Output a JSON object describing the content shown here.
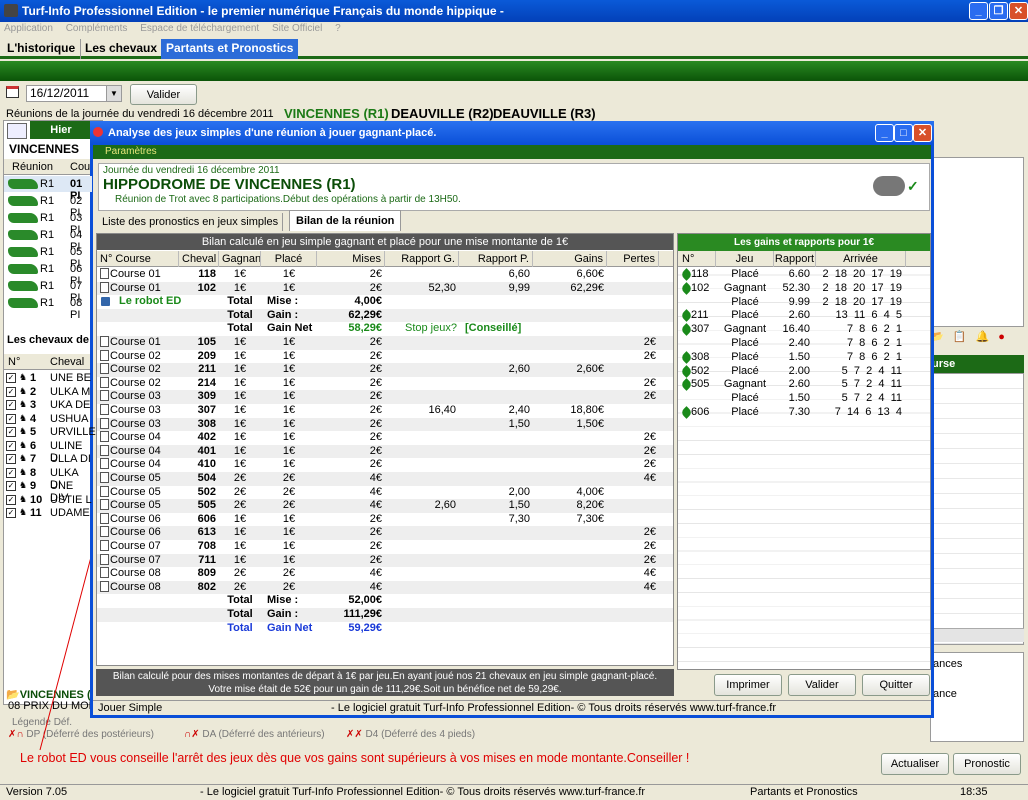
{
  "app": {
    "title": "Turf-Info Professionnel Edition - le premier numérique Français du monde hippique -"
  },
  "menu": [
    "Application",
    "Compléments",
    "Espace de téléchargement",
    "Site Officiel",
    "?"
  ],
  "tabs": [
    "L'historique",
    "Les chevaux",
    "Partants et Pronostics"
  ],
  "date": {
    "value": "16/12/2011",
    "valider": "Valider"
  },
  "reunions_label": "Réunions de la journée du vendredi 16 décembre 2011",
  "reunions": [
    "VINCENNES (R1)",
    "DEAUVILLE (R2)",
    "DEAUVILLE (R3)"
  ],
  "left": {
    "hier": "Hier",
    "venue": "VINCENNES",
    "headers": [
      "Réunion",
      "Cou"
    ],
    "rows": [
      [
        "R1",
        "01 PI"
      ],
      [
        "R1",
        "02 PI"
      ],
      [
        "R1",
        "03 PI"
      ],
      [
        "R1",
        "04 PI"
      ],
      [
        "R1",
        "05 PI"
      ],
      [
        "R1",
        "06 PI"
      ],
      [
        "R1",
        "07 PI"
      ],
      [
        "R1",
        "08 PI"
      ]
    ],
    "chevaux_label": "Les chevaux de",
    "horse_headers": [
      "N°",
      "Cheval"
    ],
    "horses": [
      [
        "1",
        "UNE BE"
      ],
      [
        "2",
        "ULKA M"
      ],
      [
        "3",
        "UKA DE"
      ],
      [
        "4",
        "USHUA"
      ],
      [
        "5",
        "URVILLE"
      ],
      [
        "6",
        "ULINE D"
      ],
      [
        "7",
        "ULLA DI"
      ],
      [
        "8",
        "ULKA DI"
      ],
      [
        "9",
        "UNE DIV"
      ],
      [
        "10",
        "USTIE L"
      ],
      [
        "11",
        "UDAME"
      ]
    ],
    "vincennes_bottom": "VINCENNES (",
    "prix": "08 PRIX DU MOR",
    "legende": "Légende Déf.",
    "legend_items": [
      "DP (Déferré des postérieurs)",
      "DA (Déferré des antérieurs)",
      "D4 (Déferré des 4 pieds)"
    ]
  },
  "annotation": "Le robot ED vous conseille l'arrêt des jeux dès que vos gains sont supérieurs à vos mises en mode montante.Conseiller !",
  "right_panel_label": "urse",
  "right_list": [
    "ances",
    "ance"
  ],
  "right_buttons": {
    "actualiser": "Actualiser",
    "pronostic": "Pronostic"
  },
  "dialog": {
    "title": "Analyse des jeux simples d'une réunion à jouer gagnant-placé.",
    "params": "Paramètres",
    "journee": "Journée du vendredi 16 décembre 2011",
    "hippodrome": "HIPPODROME DE  VINCENNES (R1)",
    "info": "Réunion de Trot avec 8 participations.Début des opérations à partir de 13H50.",
    "tabs": [
      "Liste des pronostics en jeux simples",
      "Bilan de la réunion"
    ],
    "bilan_title": "Bilan calculé en jeu simple gagnant et placé pour une mise montante de 1€",
    "headers": [
      "N° Course",
      "Cheval",
      "Gagnant",
      "Placé",
      "Mises",
      "Rapport G.",
      "Rapport P.",
      "Gains",
      "Pertes"
    ],
    "rows1": [
      [
        "Course 01",
        "118",
        "1€",
        "1€",
        "2€",
        "",
        "6,60",
        "6,60€",
        ""
      ],
      [
        "Course 01",
        "102",
        "1€",
        "1€",
        "2€",
        "52,30",
        "9,99",
        "62,29€",
        ""
      ]
    ],
    "robot": "Le robot   ED",
    "sum1": [
      [
        "Total",
        "Mise :",
        "4,00€"
      ],
      [
        "Total",
        "Gain :",
        "62,29€"
      ],
      [
        "Total",
        "Gain Net",
        "58,29€"
      ]
    ],
    "stop": "Stop jeux?",
    "conseille": "[Conseillé]",
    "rows2": [
      [
        "Course 01",
        "105",
        "1€",
        "1€",
        "2€",
        "",
        "",
        "",
        "2€"
      ],
      [
        "Course 02",
        "209",
        "1€",
        "1€",
        "2€",
        "",
        "",
        "",
        "2€"
      ],
      [
        "Course 02",
        "211",
        "1€",
        "1€",
        "2€",
        "",
        "2,60",
        "2,60€",
        ""
      ],
      [
        "Course 02",
        "214",
        "1€",
        "1€",
        "2€",
        "",
        "",
        "",
        "2€"
      ],
      [
        "Course 03",
        "309",
        "1€",
        "1€",
        "2€",
        "",
        "",
        "",
        "2€"
      ],
      [
        "Course 03",
        "307",
        "1€",
        "1€",
        "2€",
        "16,40",
        "2,40",
        "18,80€",
        ""
      ],
      [
        "Course 03",
        "308",
        "1€",
        "1€",
        "2€",
        "",
        "1,50",
        "1,50€",
        ""
      ],
      [
        "Course 04",
        "402",
        "1€",
        "1€",
        "2€",
        "",
        "",
        "",
        "2€"
      ],
      [
        "Course 04",
        "401",
        "1€",
        "1€",
        "2€",
        "",
        "",
        "",
        "2€"
      ],
      [
        "Course 04",
        "410",
        "1€",
        "1€",
        "2€",
        "",
        "",
        "",
        "2€"
      ],
      [
        "Course 05",
        "504",
        "2€",
        "2€",
        "4€",
        "",
        "",
        "",
        "4€"
      ],
      [
        "Course 05",
        "502",
        "2€",
        "2€",
        "4€",
        "",
        "2,00",
        "4,00€",
        ""
      ],
      [
        "Course 05",
        "505",
        "2€",
        "2€",
        "4€",
        "2,60",
        "1,50",
        "8,20€",
        ""
      ],
      [
        "Course 06",
        "606",
        "1€",
        "1€",
        "2€",
        "",
        "7,30",
        "7,30€",
        ""
      ],
      [
        "Course 06",
        "613",
        "1€",
        "1€",
        "2€",
        "",
        "",
        "",
        "2€"
      ],
      [
        "Course 07",
        "708",
        "1€",
        "1€",
        "2€",
        "",
        "",
        "",
        "2€"
      ],
      [
        "Course 07",
        "711",
        "1€",
        "1€",
        "2€",
        "",
        "",
        "",
        "2€"
      ],
      [
        "Course 08",
        "809",
        "2€",
        "2€",
        "4€",
        "",
        "",
        "",
        "4€"
      ],
      [
        "Course 08",
        "802",
        "2€",
        "2€",
        "4€",
        "",
        "",
        "",
        "4€"
      ]
    ],
    "sum2": [
      [
        "Total",
        "Mise :",
        "52,00€"
      ],
      [
        "Total",
        "Gain :",
        "111,29€"
      ],
      [
        "Total",
        "Gain Net",
        "59,29€"
      ]
    ],
    "footer1": "Bilan calculé pour des mises montantes de départ à 1€ par jeu.En ayant joué nos 21 chevaux en jeu simple gagnant-placé.",
    "footer2": "Votre mise était de 52€ pour un gain de 111,29€.Soit un bénéfice net de 59,29€.",
    "gains_title": "Les gains et rapports pour 1€",
    "gains_headers": [
      "N°",
      "Jeu",
      "Rapport",
      "Arrivée"
    ],
    "gains": [
      [
        "118",
        "Placé",
        "6.60",
        "2  18  20  17  19"
      ],
      [
        "102",
        "Gagnant",
        "52.30",
        "2  18  20  17  19"
      ],
      [
        "",
        "Placé",
        "9.99",
        "2  18  20  17  19"
      ],
      [
        "211",
        "Placé",
        "2.60",
        "13  11  6  4  5"
      ],
      [
        "307",
        "Gagnant",
        "16.40",
        "7  8  6  2  1"
      ],
      [
        "",
        "Placé",
        "2.40",
        "7  8  6  2  1"
      ],
      [
        "308",
        "Placé",
        "1.50",
        "7  8  6  2  1"
      ],
      [
        "502",
        "Placé",
        "2.00",
        "5  7  2  4  11"
      ],
      [
        "505",
        "Gagnant",
        "2.60",
        "5  7  2  4  11"
      ],
      [
        "",
        "Placé",
        "1.50",
        "5  7  2  4  11"
      ],
      [
        "606",
        "Placé",
        "7.30",
        "7  14  6  13  4"
      ]
    ],
    "buttons": {
      "imprimer": "Imprimer",
      "valider": "Valider",
      "quitter": "Quitter"
    },
    "status_left": "Jouer Simple",
    "status_right": "- Le logiciel gratuit Turf-Info Professionnel Edition- © Tous droits réservés www.turf-france.fr"
  },
  "statusbar": {
    "version": "Version 7.05",
    "text": "- Le logiciel gratuit Turf-Info Professionnel Edition- © Tous droits réservés www.turf-france.fr",
    "section": "Partants et Pronostics",
    "time": "18:35"
  },
  "colors": {
    "green": "#1c6a16",
    "blue": "#0a4fd8",
    "red": "#e00000"
  }
}
